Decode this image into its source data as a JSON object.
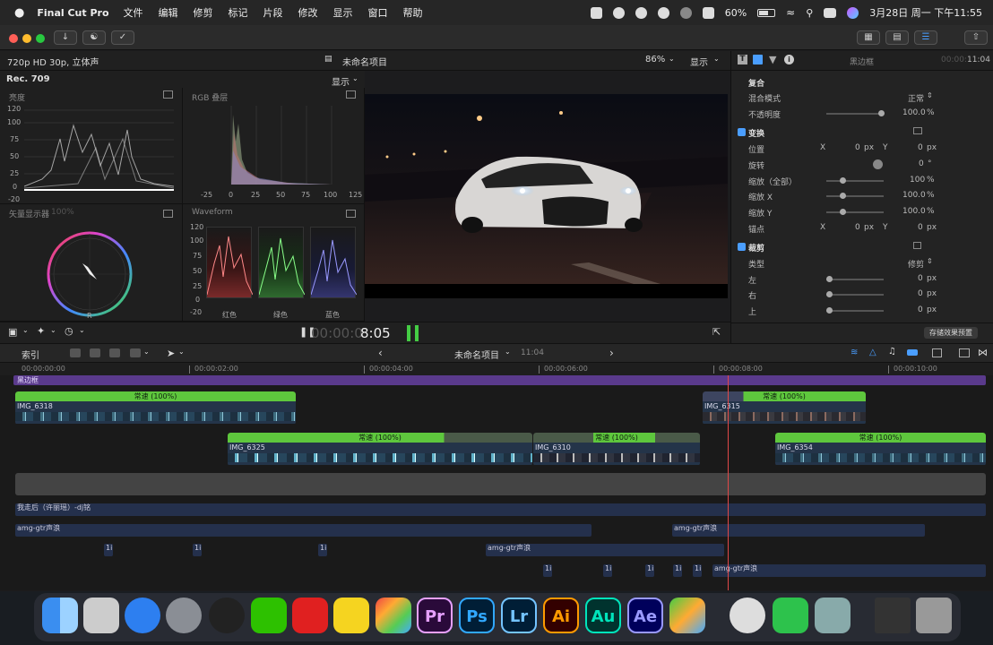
{
  "menubar": {
    "app_name": "Final Cut Pro",
    "items": [
      "文件",
      "编辑",
      "修剪",
      "标记",
      "片段",
      "修改",
      "显示",
      "窗口",
      "帮助"
    ],
    "battery": "60%",
    "datetime": "3月28日 周一 下午11:55"
  },
  "viewer": {
    "format": "720p HD 30p, 立体声",
    "project_name": "未命名项目",
    "zoom": "86%",
    "display_menu": "显示",
    "timecode_dim": "00:00:0",
    "timecode": "8:05"
  },
  "scopes": {
    "colorspace": "Rec. 709",
    "display_menu": "显示",
    "luma_title": "亮度",
    "luma_axis": [
      "120",
      "100",
      "75",
      "50",
      "25",
      "0",
      "-20"
    ],
    "rgb_title": "RGB 叠层",
    "rgb_axis": [
      "-25",
      "0",
      "25",
      "50",
      "75",
      "100",
      "125"
    ],
    "vector_title": "矢量显示器",
    "vector_pct": "100%",
    "vector_labels": [
      "R",
      "MG",
      "B",
      "CY",
      "G",
      "YL"
    ],
    "wave_title": "Waveform",
    "wave_axis": [
      "120",
      "100",
      "75",
      "50",
      "25",
      "0",
      "-20"
    ],
    "wave_channels": [
      "红色",
      "绿色",
      "蓝色"
    ]
  },
  "inspector": {
    "title": "黑边框",
    "duration_dim": "00:00:",
    "duration": "11:04",
    "sections": {
      "composite": "复合",
      "blend_label": "混合模式",
      "blend_value": "正常",
      "opacity_label": "不透明度",
      "opacity_value": "100.0",
      "transform": "变换",
      "position_label": "位置",
      "rotation_label": "旋转",
      "rotation_value": "0",
      "scale_all_label": "缩放（全部）",
      "scale_all_value": "100",
      "scale_x_label": "缩放 X",
      "scale_x_value": "100.0",
      "scale_y_label": "缩放 Y",
      "scale_y_value": "100.0",
      "anchor_label": "锚点",
      "crop": "裁剪",
      "type_label": "类型",
      "type_value": "修剪",
      "left_label": "左",
      "right_label": "右",
      "top_label": "上",
      "zero": "0",
      "px": "px",
      "pct": "%",
      "deg": "°",
      "x": "X",
      "y": "Y"
    },
    "save_preset": "存储效果预置"
  },
  "timeline": {
    "index_button": "索引",
    "project_name": "未命名项目",
    "duration": "11:04",
    "ruler": [
      "00:00:00:00",
      "00:00:02:00",
      "00:00:04:00",
      "00:00:06:00",
      "00:00:08:00",
      "00:00:10:00"
    ],
    "title_clip": "黑边框",
    "speed_label": "常速 (100%)",
    "clips": [
      "IMG_6318",
      "IMG_6315",
      "IMG_6325",
      "IMG_6310",
      "IMG_6354"
    ],
    "music": "我走后（许丽瑶）-dj铭",
    "sfx": "amg-gtr声浪",
    "small_label": "1i"
  },
  "dock": {
    "apps": [
      "finder",
      "launchpad",
      "safari",
      "system-preferences",
      "qq",
      "wechat",
      "netease-music",
      "qq-music",
      "final-cut-pro",
      "Pr",
      "Ps",
      "Lr",
      "Ai",
      "Au",
      "Ae",
      "infuse",
      "quicktime",
      "facetime",
      "preview",
      "screenshot",
      "trash"
    ]
  }
}
